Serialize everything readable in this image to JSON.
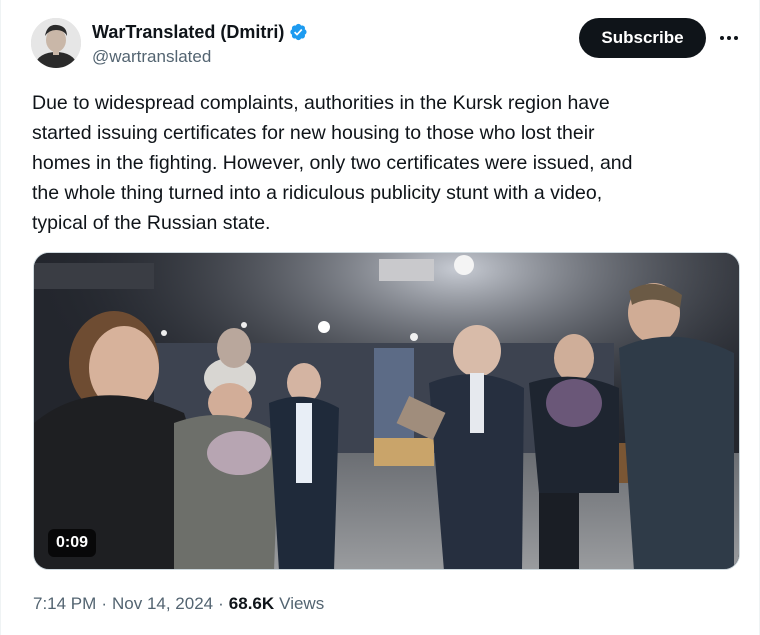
{
  "author": {
    "display_name": "WarTranslated (Dmitri)",
    "handle": "@wartranslated",
    "verified_icon": "verified-badge-icon",
    "avatar_icon": "avatar-portrait"
  },
  "actions": {
    "subscribe_label": "Subscribe",
    "more_icon": "more-horizontal-icon"
  },
  "tweet": {
    "text": "Due to widespread complaints, authorities in the Kursk region have\nstarted issuing certificates for new housing to those who lost their\nhomes in the fighting. However, only two certificates were issued, and\nthe whole thing turned into a ridiculous publicity stunt with a video,\ntypical of the Russian state."
  },
  "media": {
    "type": "video",
    "duration": "0:09"
  },
  "meta": {
    "time": "7:14 PM",
    "separator": "·",
    "date": "Nov 14, 2024",
    "views_count": "68.6K",
    "views_label": "Views"
  },
  "colors": {
    "text_primary": "#0f1419",
    "text_secondary": "#536471",
    "verified_blue": "#1d9bf0",
    "button_dark": "#0f1419"
  }
}
